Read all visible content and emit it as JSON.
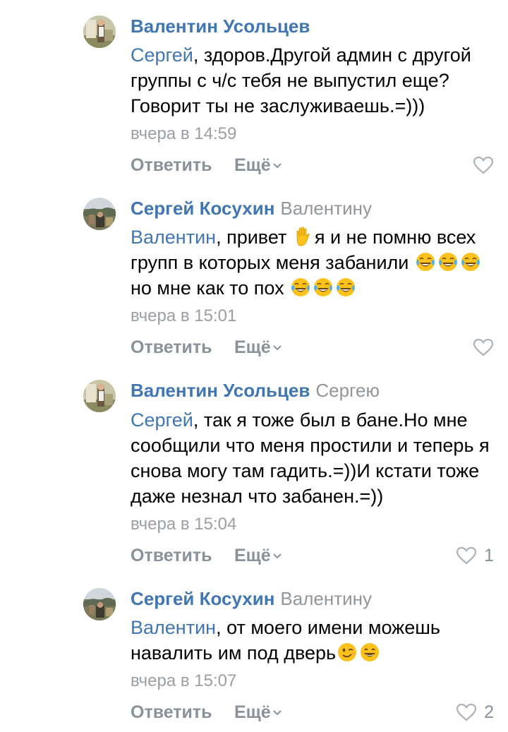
{
  "comments": [
    {
      "author": "Валентин Усольцев",
      "reply_to": "",
      "mention": "Сергей",
      "text_parts": [
        ", здоров.Другой админ с другой группы с ч/с тебя не выпустил еще? Говорит ты не заслуживаешь.=)))"
      ],
      "time": "вчера в 14:59",
      "reply_label": "Ответить",
      "more_label": "Ещё",
      "likes": ""
    },
    {
      "author": "Сергей Косухин",
      "reply_to": "Валентину",
      "mention": "Валентин",
      "text_parts": [
        ", привет ",
        "я и не помню всех групп в которых меня забанили ",
        "но мне как то пох "
      ],
      "emojis": [
        "raised-hand-emoji",
        "tears-of-joy-emoji",
        "tears-of-joy-emoji"
      ],
      "time": "вчера в 15:01",
      "reply_label": "Ответить",
      "more_label": "Ещё",
      "likes": ""
    },
    {
      "author": "Валентин Усольцев",
      "reply_to": "Сергею",
      "mention": "Сергей",
      "text_parts": [
        ", так я тоже был в бане.Но мне сообщили что меня простили и теперь я снова могу там гадить.=))И кстати тоже даже незнал что забанен.=))"
      ],
      "time": "вчера в 15:04",
      "reply_label": "Ответить",
      "more_label": "Ещё",
      "likes": "1"
    },
    {
      "author": "Сергей Косухин",
      "reply_to": "Валентину",
      "mention": "Валентин",
      "text_parts": [
        ", от моего имени можешь навалить им под дверь"
      ],
      "emojis": [
        "winking-emoji",
        "grinning-emoji"
      ],
      "time": "вчера в 15:07",
      "reply_label": "Ответить",
      "more_label": "Ещё",
      "likes": "2"
    }
  ],
  "colors": {
    "link": "#3f76b3",
    "secondary": "#939699",
    "action": "#8a9199"
  }
}
